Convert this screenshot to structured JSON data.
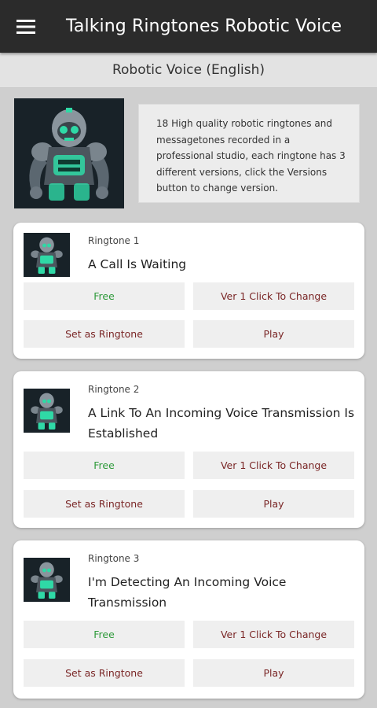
{
  "appbar": {
    "title": "Talking Ringtones Robotic Voice",
    "menu_icon": "hamburger-menu-icon"
  },
  "subheader": {
    "title": "Robotic Voice (English)"
  },
  "intro": {
    "image": "robot-cover-image",
    "description": "18 High quality robotic ringtones and messagetones recorded in a professional studio, each ringtone has 3 different versions, click the Versions button to change version."
  },
  "colors": {
    "appbar": "#2b2b2b",
    "free_text": "#2e9a3a",
    "action_text": "#7a2626",
    "robot_accent": "#2fd9a6"
  },
  "ringtones": [
    {
      "label": "Ringtone 1",
      "title": "A Call Is Waiting",
      "free": "Free",
      "version": "Ver 1 Click To Change",
      "set": "Set as Ringtone",
      "play": "Play"
    },
    {
      "label": "Ringtone 2",
      "title": "A Link To An Incoming Voice Transmission Is Established",
      "free": "Free",
      "version": "Ver 1 Click To Change",
      "set": "Set as Ringtone",
      "play": "Play"
    },
    {
      "label": "Ringtone 3",
      "title": "I'm Detecting An Incoming Voice Transmission",
      "free": "Free",
      "version": "Ver 1 Click To Change",
      "set": "Set as Ringtone",
      "play": "Play"
    }
  ]
}
